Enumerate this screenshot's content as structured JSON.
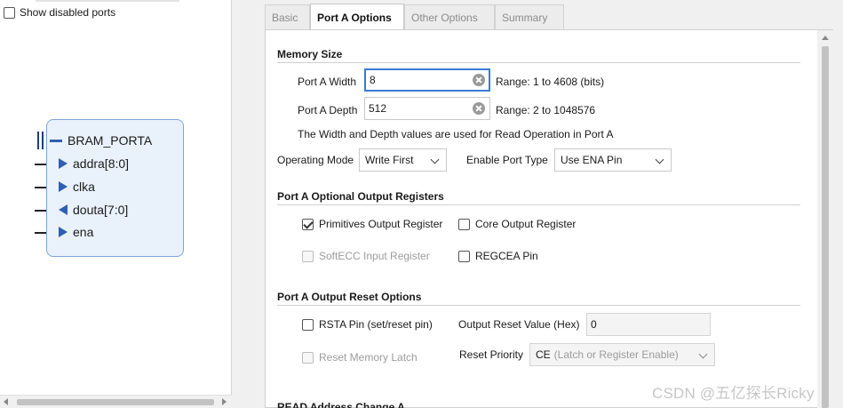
{
  "left_panel": {
    "show_disabled_label": "Show disabled ports",
    "block": {
      "title": "BRAM_PORTA",
      "ports": [
        {
          "name": "addra[8:0]",
          "direction": "in"
        },
        {
          "name": "clka",
          "direction": "in"
        },
        {
          "name": "douta[7:0]",
          "direction": "out"
        },
        {
          "name": "ena",
          "direction": "in"
        }
      ]
    }
  },
  "tabs": [
    "Basic",
    "Port A Options",
    "Other Options",
    "Summary"
  ],
  "active_tab": "Port A Options",
  "memory_size": {
    "title": "Memory Size",
    "width_label": "Port A Width",
    "width_value": "8",
    "width_range": "Range: 1 to 4608 (bits)",
    "depth_label": "Port A Depth",
    "depth_value": "512",
    "depth_range": "Range: 2 to 1048576",
    "note": "The Width and Depth values are used for Read Operation in Port A",
    "operating_mode_label": "Operating Mode",
    "operating_mode_value": "Write First",
    "enable_port_type_label": "Enable Port Type",
    "enable_port_type_value": "Use ENA Pin"
  },
  "optional_output_registers": {
    "title": "Port A Optional Output Registers",
    "primitives_label": "Primitives Output Register",
    "primitives_checked": true,
    "core_label": "Core Output Register",
    "core_checked": false,
    "softecc_label": "SoftECC Input Register",
    "softecc_checked": false,
    "regcea_label": "REGCEA Pin",
    "regcea_checked": false
  },
  "output_reset_options": {
    "title": "Port A Output Reset Options",
    "rsta_label": "RSTA Pin (set/reset pin)",
    "rsta_checked": false,
    "reset_value_label": "Output Reset Value (Hex)",
    "reset_value": "0",
    "reset_memory_latch_label": "Reset Memory Latch",
    "reset_memory_latch_checked": false,
    "reset_priority_label": "Reset Priority",
    "reset_priority_main": "CE",
    "reset_priority_sub": "(Latch or Register Enable)"
  },
  "next_section_partial": "READ Address Change A",
  "watermark": "CSDN @五亿探长Ricky",
  "colors": {
    "accent": "#3a7bd5",
    "port_blue": "#2f5fb3",
    "block_fill": "#e9f1fb"
  }
}
